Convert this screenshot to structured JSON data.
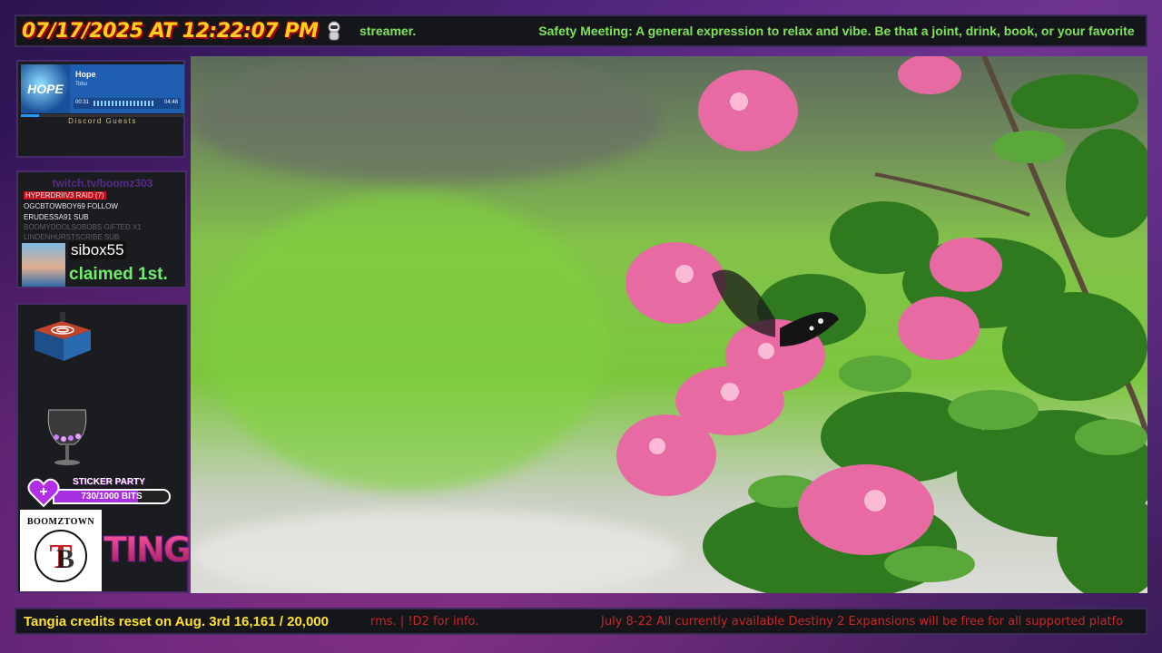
{
  "topbar": {
    "clock": "07/17/2025 AT 12:22:07 PM",
    "ticker_left": "streamer.",
    "ticker_right": "Safety Meeting: A general expression to relax and vibe. Be that a joint, drink, book, or your favorite"
  },
  "music_widget": {
    "album_text": "HOPE",
    "song": "Hope",
    "artist": "Tobu",
    "time_elapsed": "00:31",
    "time_total": "04:48",
    "progress": 0.11,
    "footer": "Discord Guests"
  },
  "events_panel": {
    "channel": "twitch.tv/boomz303",
    "events": [
      {
        "text": "HYPERDRIIV3 RAID (7)",
        "type": "raid"
      },
      {
        "text": "OGCBTOWBOY69 FOLLOW",
        "type": "normal"
      },
      {
        "text": "ERUDESSA91 SUB",
        "type": "normal"
      },
      {
        "text": "BOOMYDOOLSOBOBS GIFTED X1",
        "type": "faded"
      },
      {
        "text": "LINDENHURSTSCRIBE SUB",
        "type": "faded"
      }
    ],
    "claim_name": "sibox55",
    "claim_text": "claimed 1st."
  },
  "goals_panel": {
    "sticker_label": "STICKER PARTY",
    "sticker_amount": "730/1000 BITS",
    "sticker_progress": 0.73,
    "logo_text": "BOOMZTOWN",
    "logo_letter": "TB",
    "banner_fragment": "TING"
  },
  "bottombar": {
    "credits": "Tangia credits reset on Aug. 3rd 16,161 / 20,000",
    "ticker_mid": "rms. | !D2 for info.",
    "ticker_right": "July 8-22 All currently available Destiny 2 Expansions will be free for all supported platfo"
  },
  "colors": {
    "clock": "#ffd21a",
    "ticker_green": "#7fe35a",
    "credits_yellow": "#ffe12a",
    "ticker_red": "#c62828",
    "panel_border": "#4a2b6a"
  }
}
